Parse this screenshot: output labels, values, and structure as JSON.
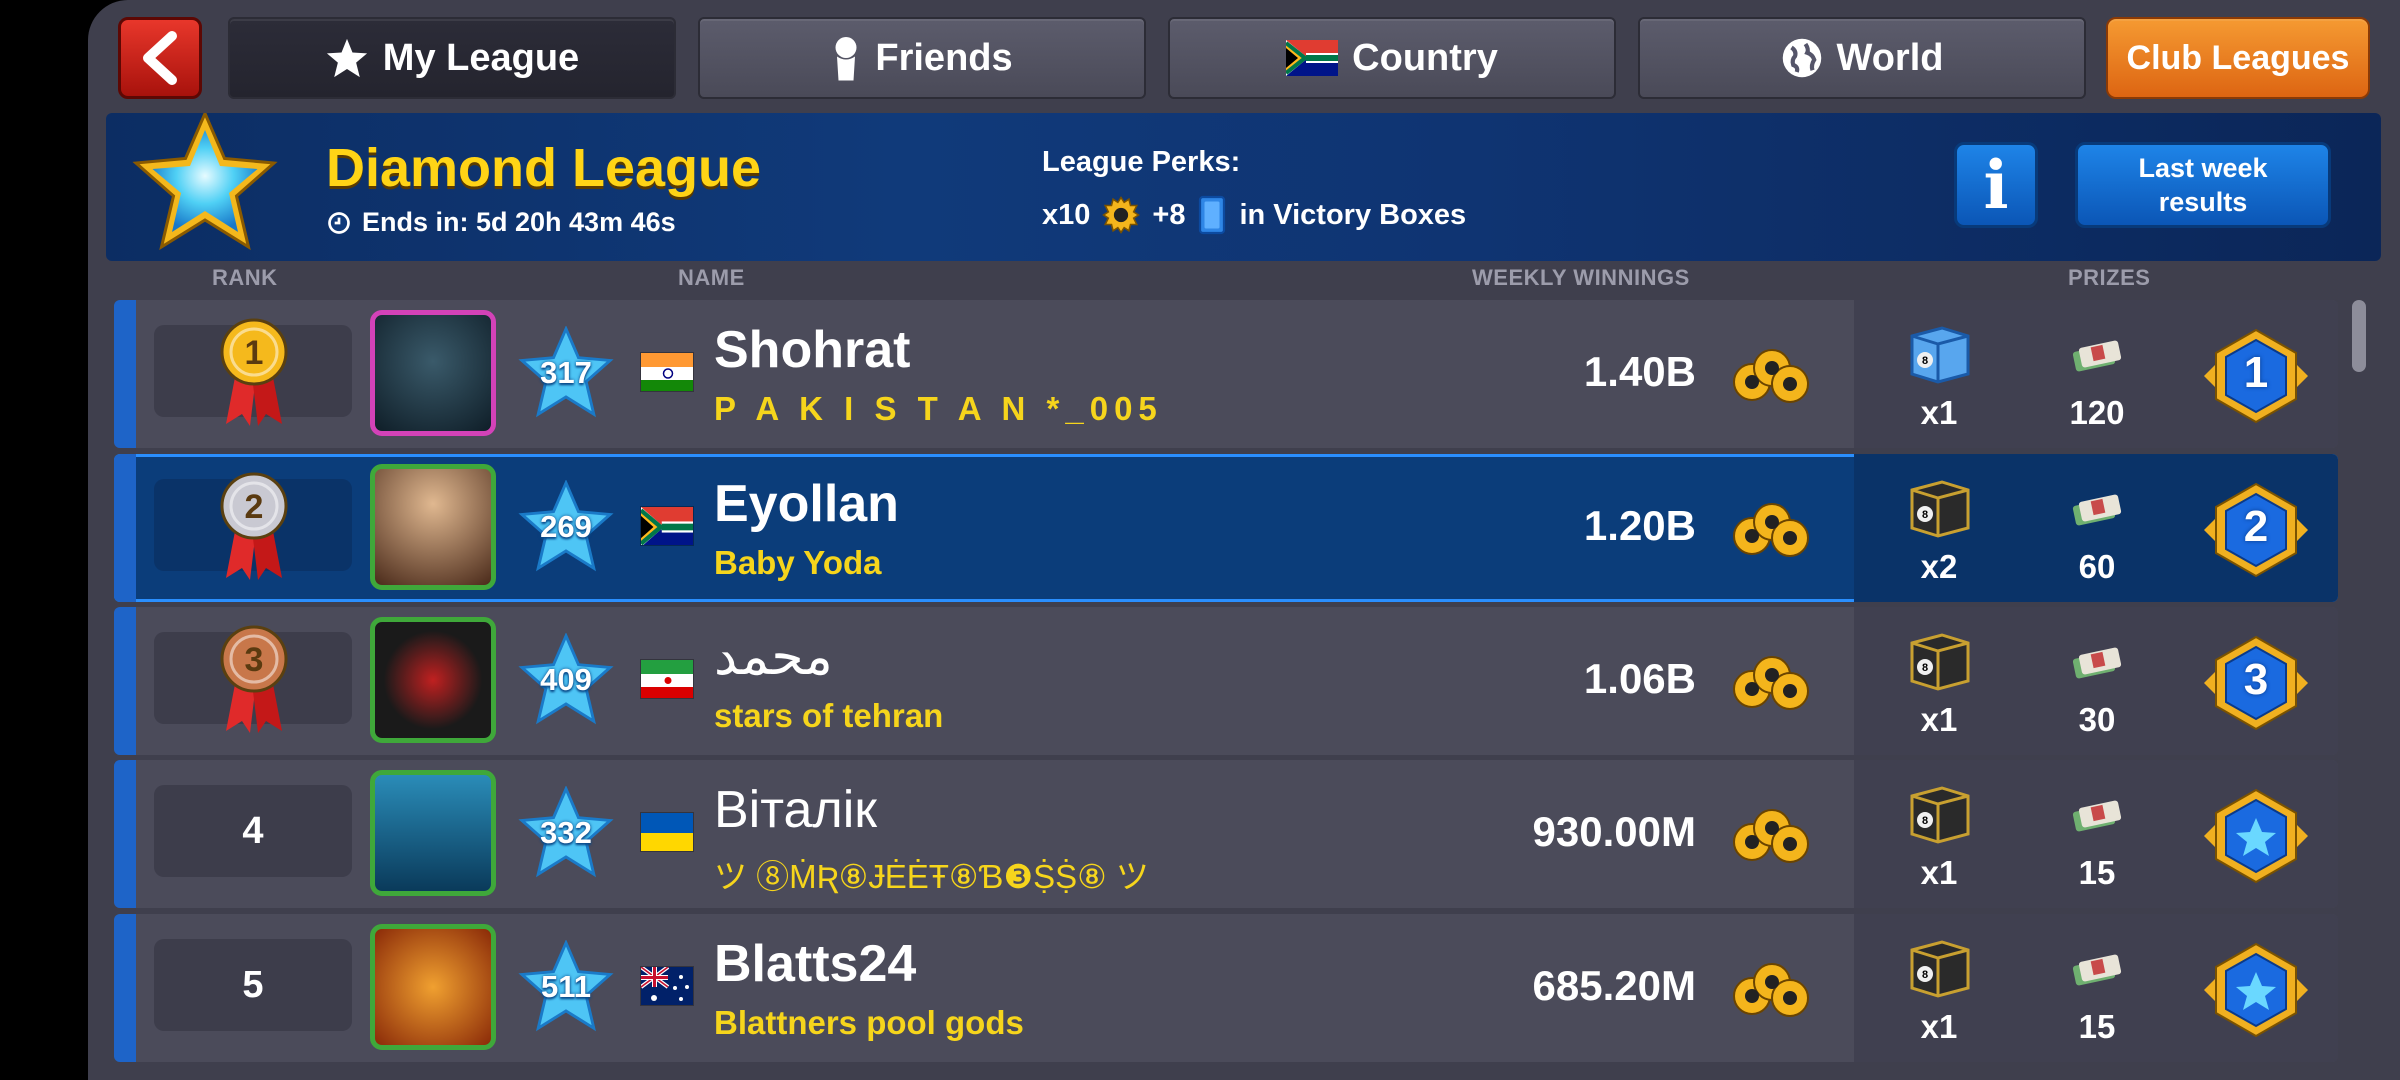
{
  "tabs": {
    "back_icon": "chevron-left-icon",
    "my_league": "My League",
    "friends": "Friends",
    "country": "Country",
    "world": "World",
    "club_leagues": "Club Leagues"
  },
  "banner": {
    "title": "Diamond League",
    "ends_in": "Ends in: 5d 20h 43m 46s",
    "perks_label": "League Perks:",
    "perk_coins": "x10",
    "perk_cards": "+8",
    "perk_suffix": "in Victory Boxes",
    "info_label": "i",
    "last_week_line1": "Last week",
    "last_week_line2": "results"
  },
  "columns": {
    "rank": "RANK",
    "name": "NAME",
    "weekly": "WEEKLY WINNINGS",
    "prizes": "PRIZES"
  },
  "colors": {
    "accent_gold": "#ffd416",
    "club_name": "#f6d51c",
    "highlight_row": "#0b3d7a",
    "club_tab": "#f08a26"
  },
  "rows": [
    {
      "rank": "1",
      "level": "317",
      "name": "Shohrat",
      "club": "P A K I S T A N *_005",
      "winnings": "1.40B",
      "box_qty": "x1",
      "cash": "120",
      "badge": "1",
      "flag": "india"
    },
    {
      "rank": "2",
      "level": "269",
      "name": "Eyollan",
      "club": "Baby Yoda",
      "winnings": "1.20B",
      "box_qty": "x2",
      "cash": "60",
      "badge": "2",
      "flag": "south-africa"
    },
    {
      "rank": "3",
      "level": "409",
      "name": "محمد",
      "club": "stars of tehran",
      "winnings": "1.06B",
      "box_qty": "x1",
      "cash": "30",
      "badge": "3",
      "flag": "iran"
    },
    {
      "rank": "4",
      "level": "332",
      "name": "Віталік",
      "club": "ツ ⑧ṀƦ⑧ɈĖĖŦ⑧Ɓ❸ṨṨ⑧ ツ",
      "winnings": "930.00M",
      "box_qty": "x1",
      "cash": "15",
      "badge": "",
      "flag": "ukraine"
    },
    {
      "rank": "5",
      "level": "511",
      "name": "Blatts24",
      "club": "Blattners pool gods",
      "winnings": "685.20M",
      "box_qty": "x1",
      "cash": "15",
      "badge": "",
      "flag": "australia"
    }
  ]
}
